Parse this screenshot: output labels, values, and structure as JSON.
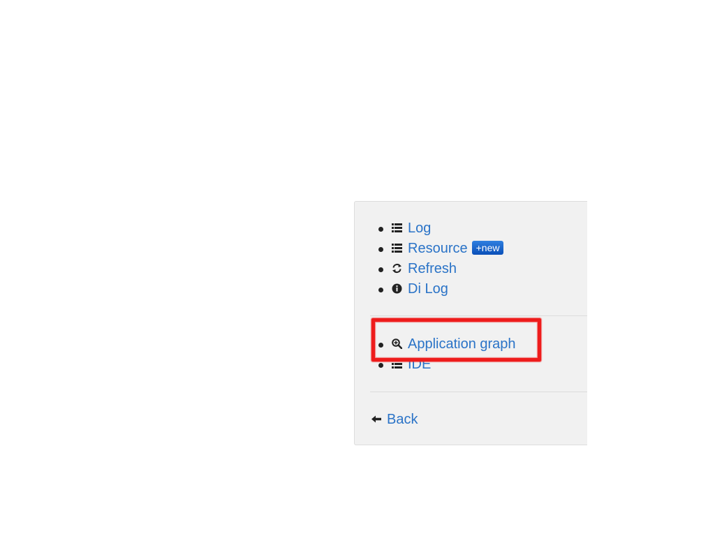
{
  "menu": {
    "items": [
      {
        "label": "Log",
        "icon": "list-icon"
      },
      {
        "label": "Resource",
        "icon": "list-icon",
        "badge": "+new"
      },
      {
        "label": "Refresh",
        "icon": "refresh-icon"
      },
      {
        "label": "Di Log",
        "icon": "info-icon"
      }
    ],
    "secondary_items": [
      {
        "label": "Application graph",
        "icon": "zoom-in-icon"
      },
      {
        "label": "IDE",
        "icon": "list-icon"
      }
    ],
    "back_label": "Back"
  },
  "colors": {
    "link": "#2a73c7",
    "panel_background": "#f1f1f1",
    "badge": "#1a62cc",
    "highlight": "#ee1c1c"
  }
}
